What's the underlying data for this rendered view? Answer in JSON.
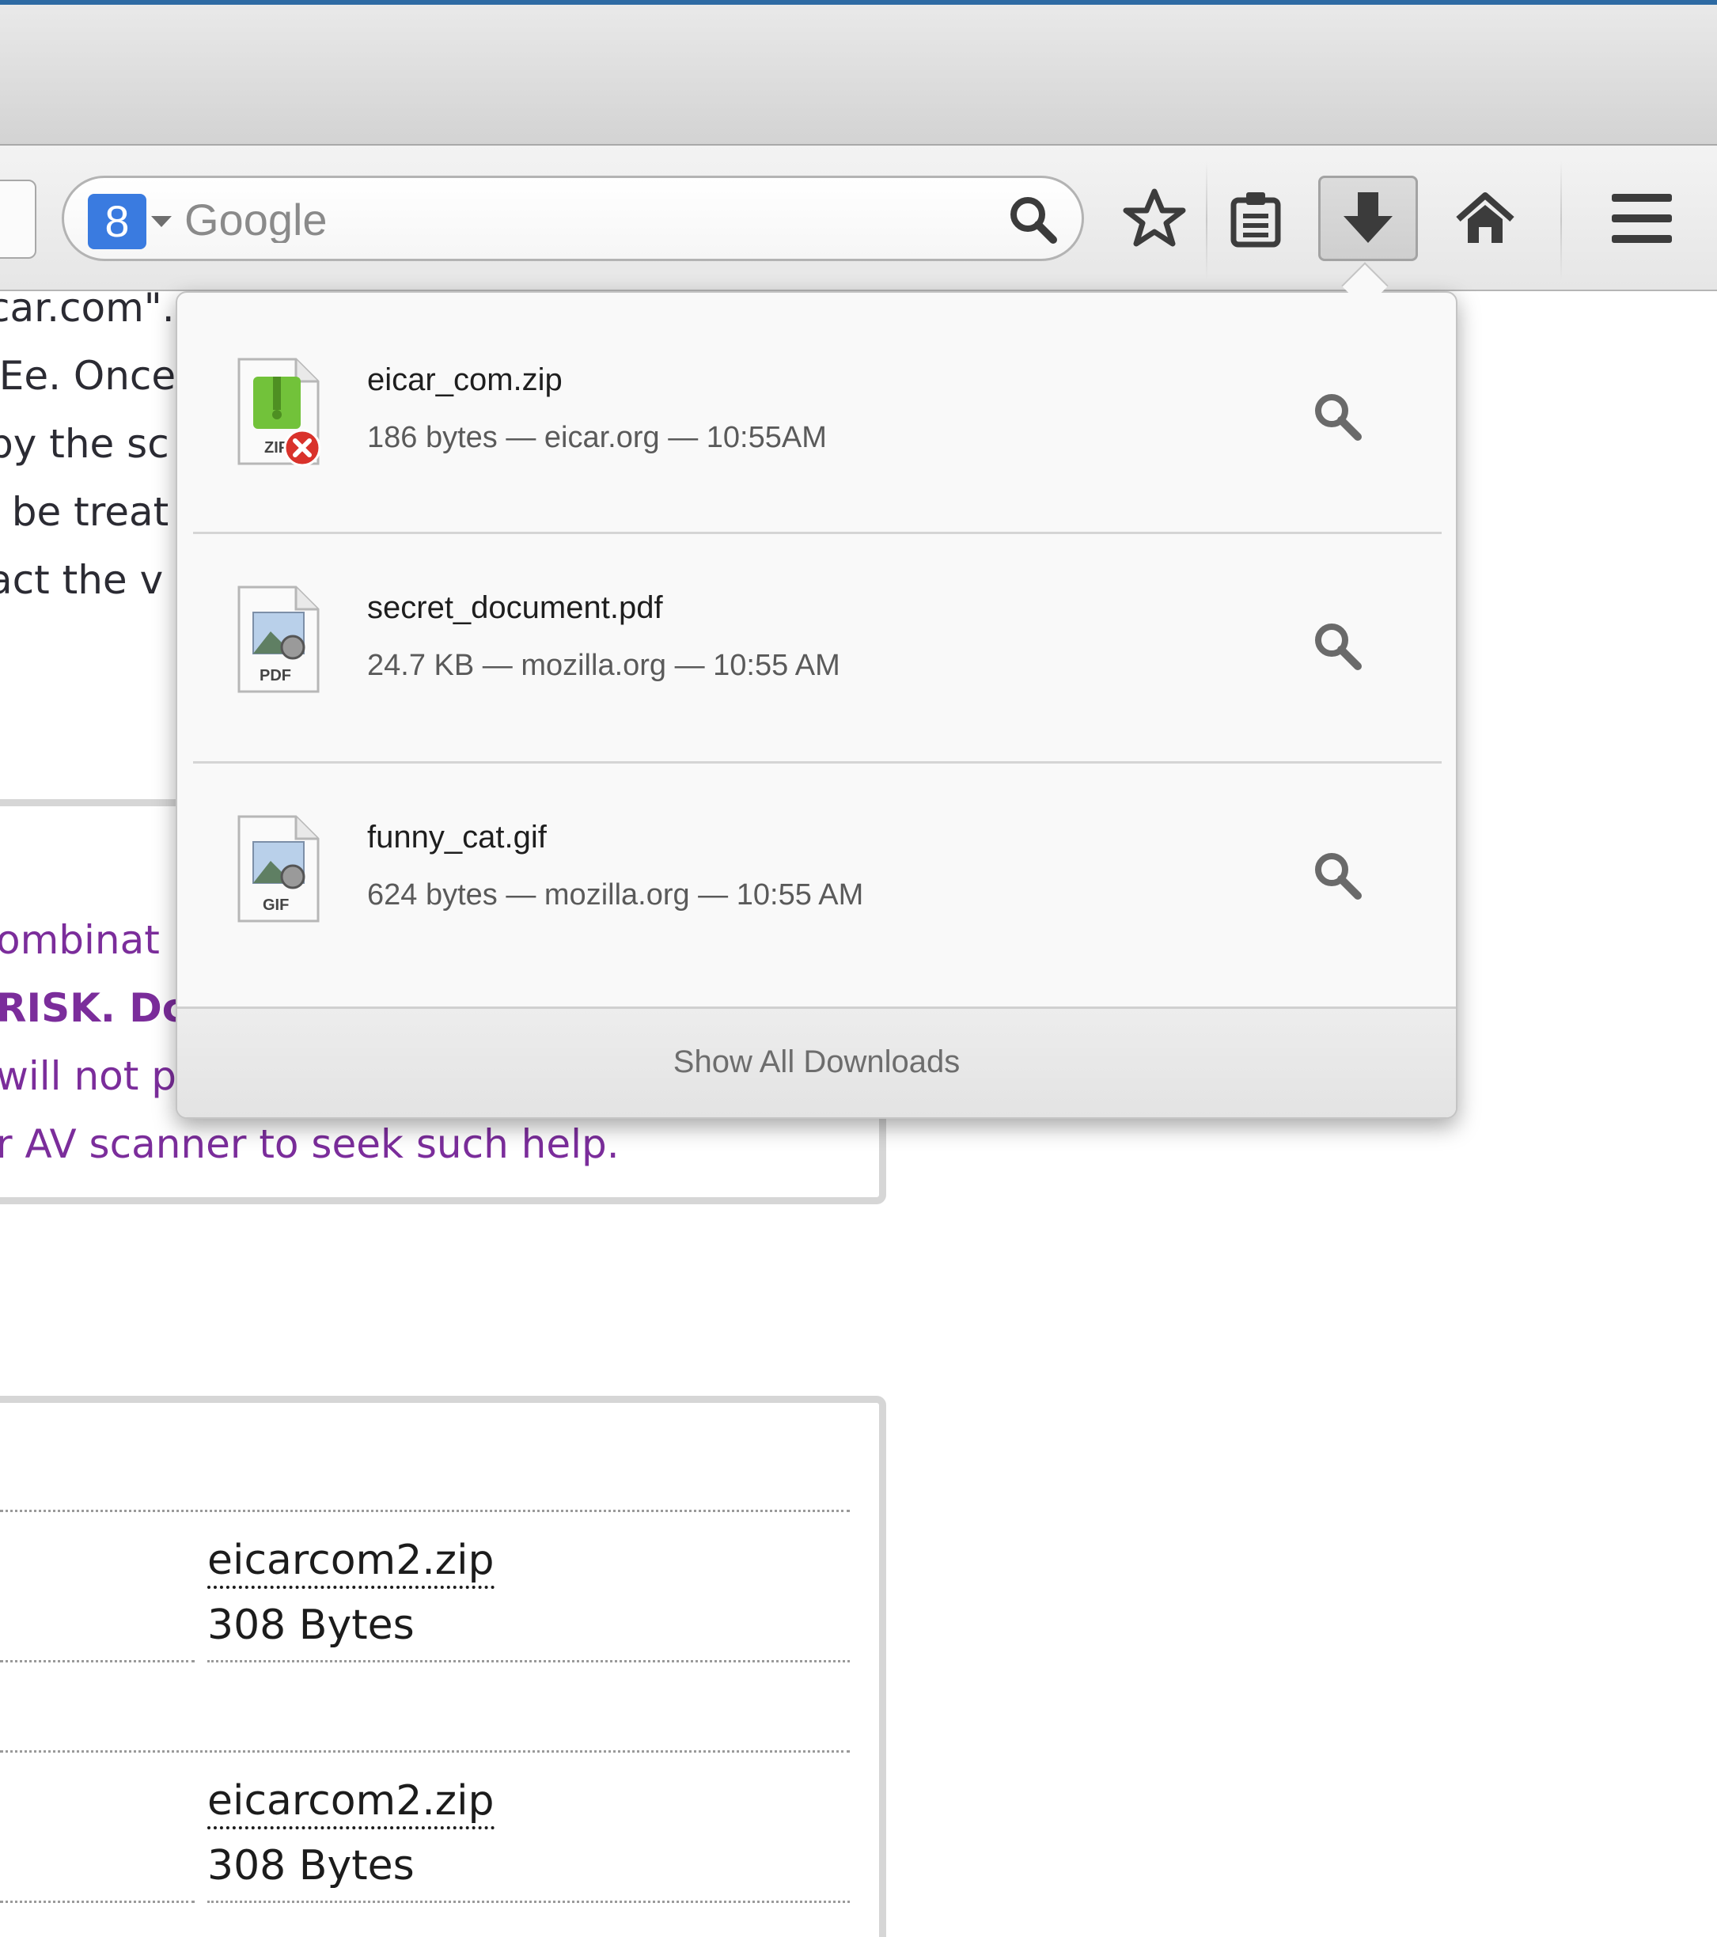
{
  "browser": {
    "search": {
      "engine_badge": "8",
      "engine_icon": "google-icon",
      "placeholder": "Google",
      "go_icon": "magnifier-icon"
    },
    "toolbar_icons": [
      "bookmark-star-icon",
      "reading-list-icon",
      "downloads-arrow-icon",
      "home-icon",
      "hamburger-menu-icon"
    ]
  },
  "page": {
    "text_lines": [
      "car.com\".",
      "'Ee. Once",
      " by the sc",
      "l be treat",
      "act the v"
    ],
    "warning_lines": [
      "ombinat",
      "RISK.  Dc",
      "will not p",
      "r AV scanner to seek such help."
    ],
    "files": [
      {
        "name": "eicarcom2.zip",
        "size": "308 Bytes"
      },
      {
        "name": "eicarcom2.zip",
        "size": "308 Bytes"
      }
    ]
  },
  "downloads_panel": {
    "items": [
      {
        "name": "eicar_com.zip",
        "meta": "186 bytes — eicar.org — 10:55AM",
        "type_label": "ZIP",
        "blocked": true
      },
      {
        "name": "secret_document.pdf",
        "meta": "24.7 KB — mozilla.org — 10:55 AM",
        "type_label": "PDF",
        "blocked": false
      },
      {
        "name": "funny_cat.gif",
        "meta": "624 bytes — mozilla.org — 10:55 AM",
        "type_label": "GIF",
        "blocked": false
      }
    ],
    "footer_label": "Show All Downloads"
  },
  "colors": {
    "title_accent": "#2d6aa3",
    "engine_blue": "#3a7be0",
    "warning_purple": "#7b2d9b",
    "blocked_red": "#d9322b",
    "zip_green": "#72c23a"
  }
}
